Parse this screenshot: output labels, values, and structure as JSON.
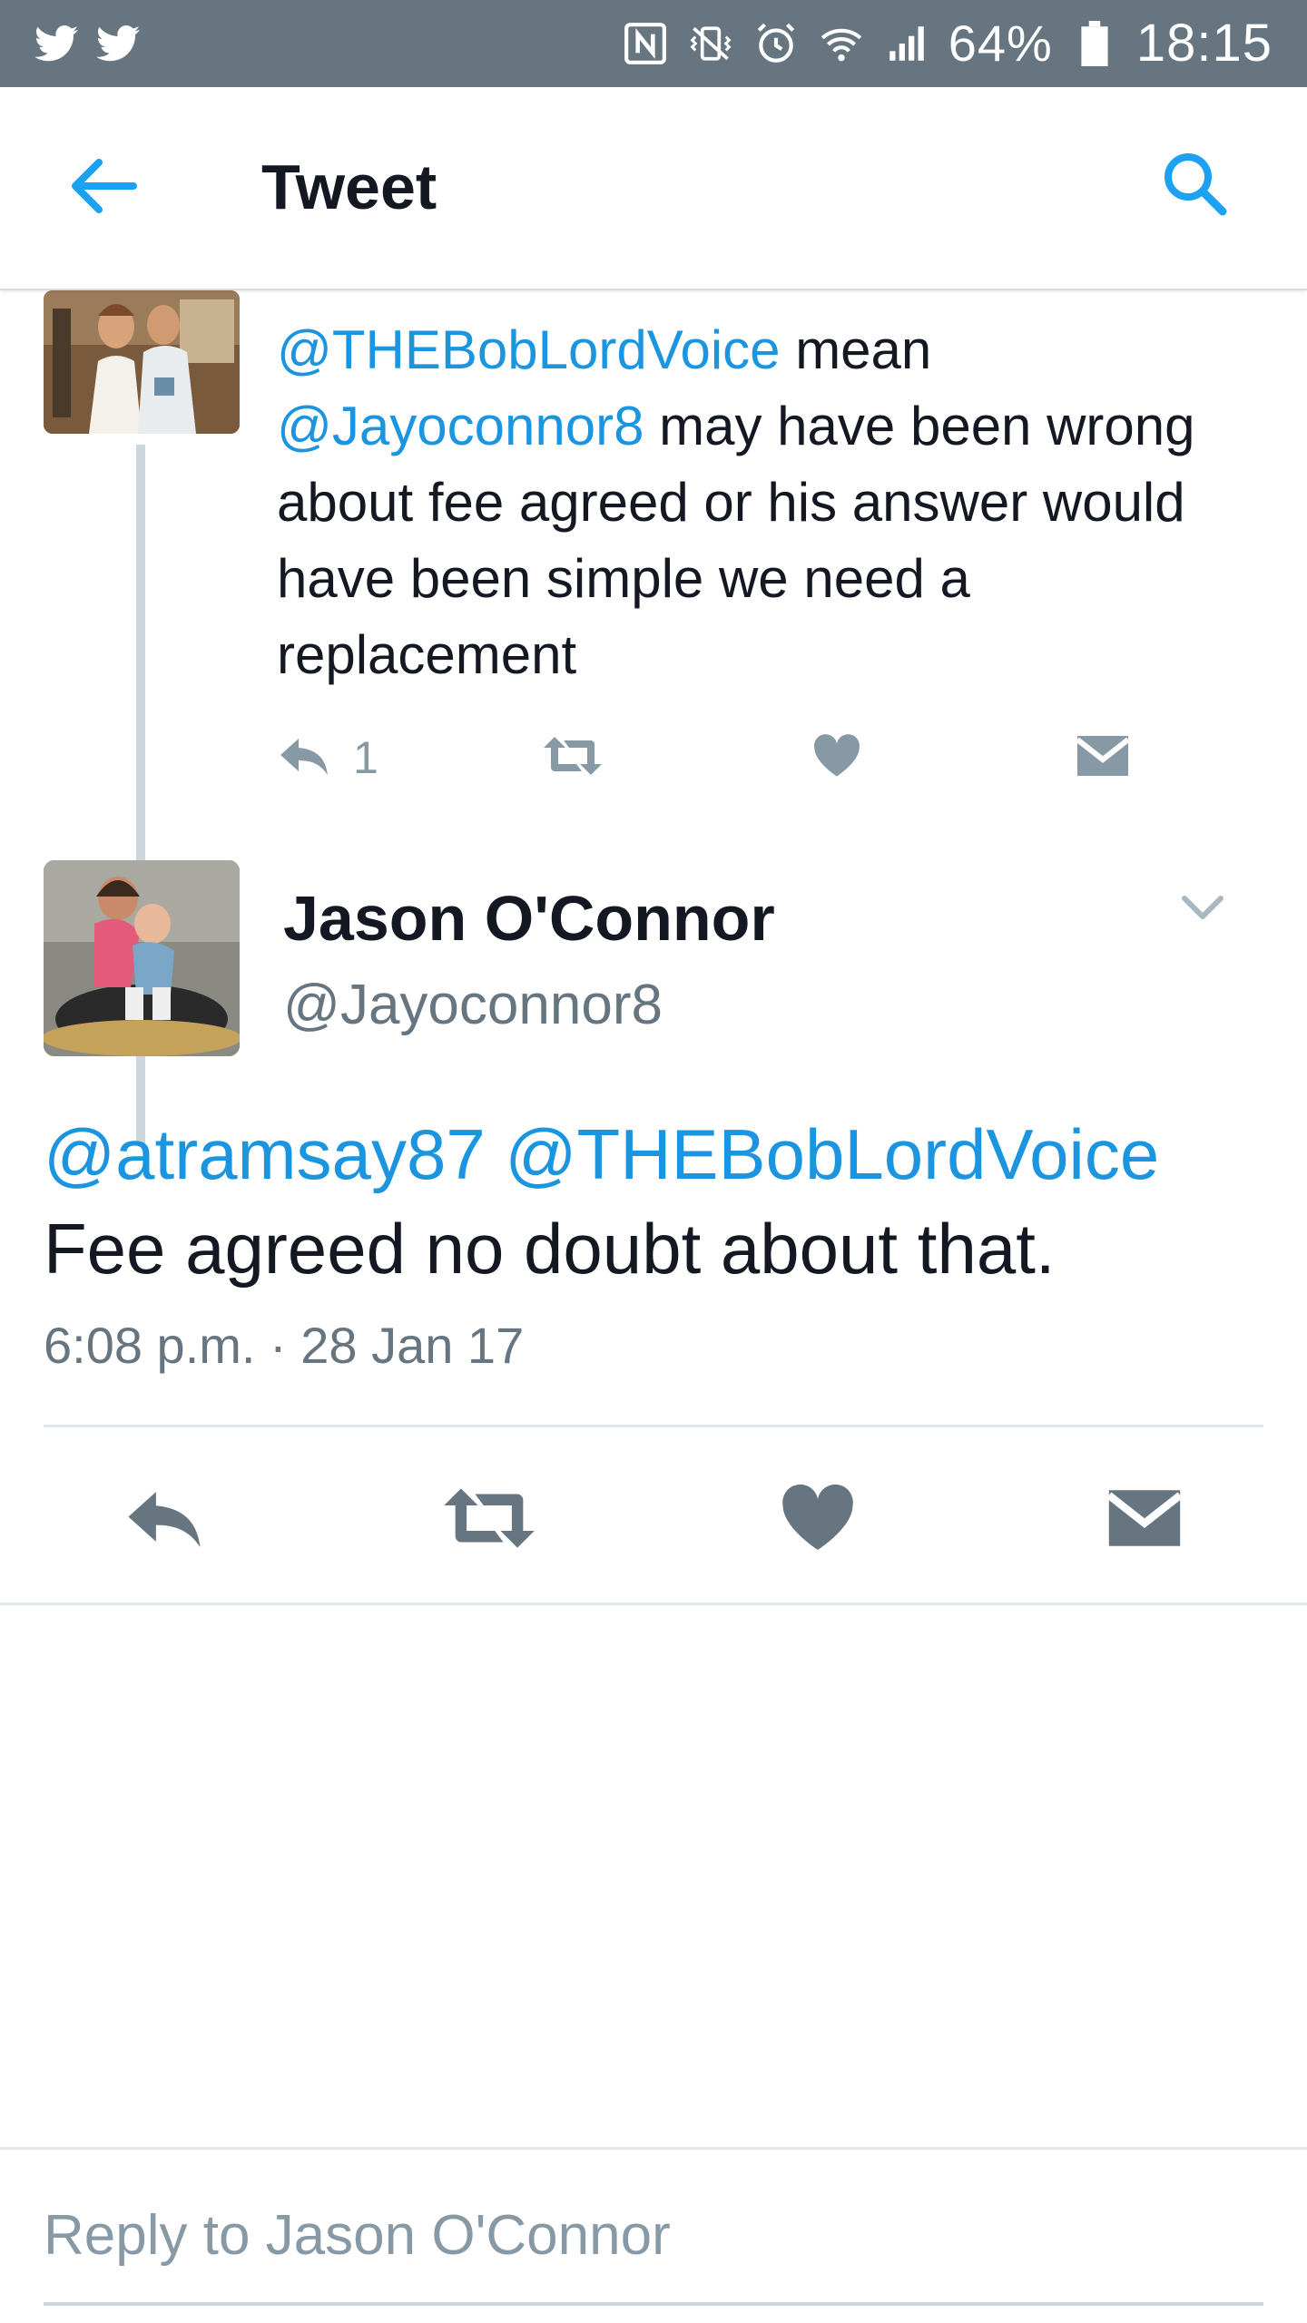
{
  "status_bar": {
    "left_icons": [
      "twitter-bird-icon",
      "twitter-bird-icon"
    ],
    "right_icons": [
      "nfc-icon",
      "vibrate-icon",
      "alarm-icon",
      "wifi-icon",
      "signal-icon"
    ],
    "battery": "64%",
    "time": "18:15"
  },
  "header": {
    "title": "Tweet",
    "back_icon": "arrow-left-icon",
    "search_icon": "search-icon",
    "accent_color": "#1da1f2"
  },
  "parent_tweet": {
    "mention_1": "@THEBobLordVoice",
    "text_1": " mean",
    "mention_2": "@Jayoconnor8",
    "text_2": "  may have been wrong about fee agreed or his answer would have been simple we need a replacement",
    "reply_count": "1"
  },
  "main_tweet": {
    "author_name": "Jason O'Connor",
    "author_handle": "@Jayoconnor8",
    "mention_1": "@atramsay87",
    "mention_2": "@THEBobLordVoice",
    "body": "Fee agreed no doubt about that.",
    "timestamp": "6:08 p.m. · 28 Jan 17"
  },
  "reply_bar": {
    "placeholder": "Reply to Jason O'Connor"
  },
  "colors": {
    "status_bar": "#66757f",
    "mention": "#1b95e0",
    "icon_gray": "#8899a6",
    "main_icon": "#66757f"
  }
}
